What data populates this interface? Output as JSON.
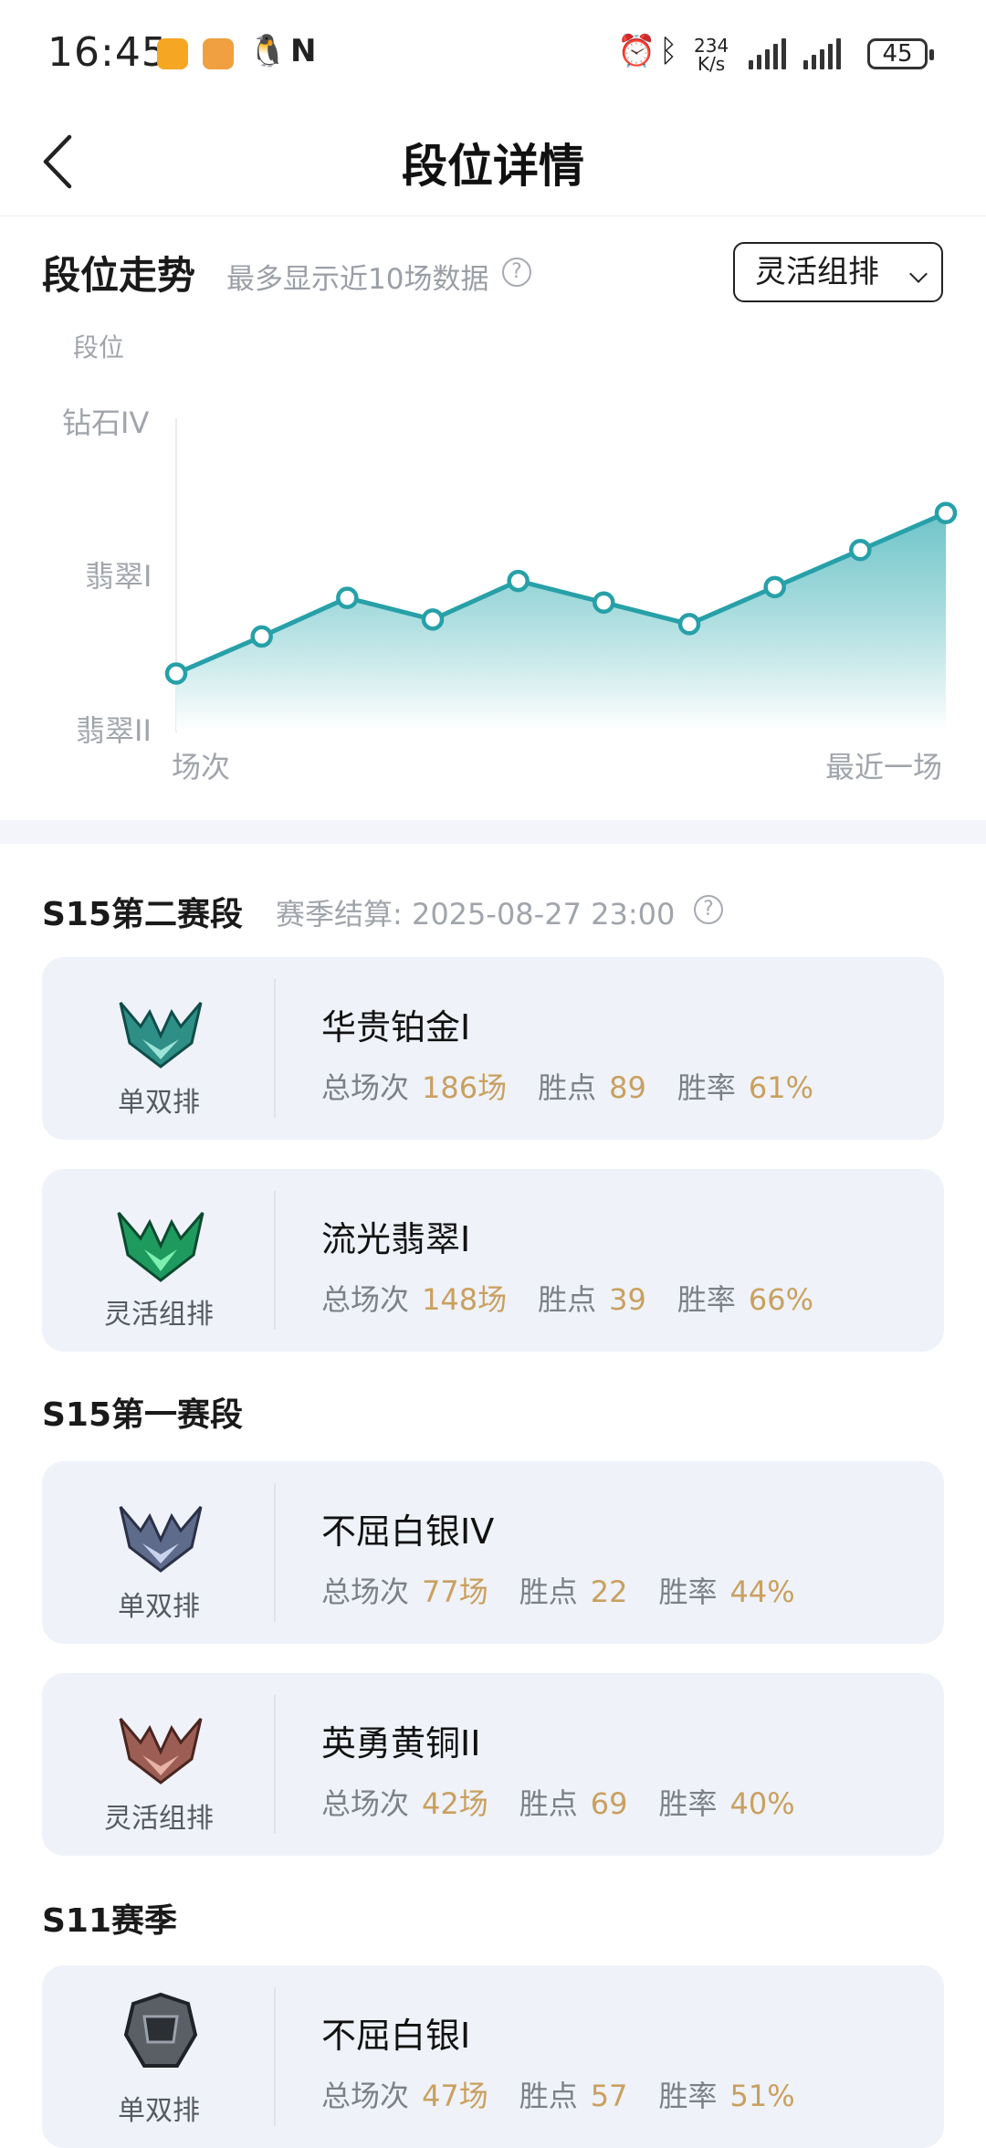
{
  "status_bar": {
    "time": "16:45",
    "net_speed_value": "234",
    "net_speed_unit": "K/s",
    "battery": "45"
  },
  "header": {
    "title": "段位详情"
  },
  "trend": {
    "title": "段位走势",
    "subtitle": "最多显示近10场数据",
    "mode_selected": "灵活组排",
    "chart_data": {
      "type": "area",
      "ylabel": "段位",
      "y_tick_labels": [
        "钻石IV",
        "翡翠I",
        "翡翠II"
      ],
      "x_start_label": "场次",
      "x_end_label": "最近一场",
      "y_scale": "rank tiers (翡翠II = 0, 翡翠I = 1, 钻石IV = 2)",
      "ylim": [
        0,
        2
      ],
      "x": [
        1,
        2,
        3,
        4,
        5,
        6,
        7,
        8,
        9,
        10
      ],
      "values": [
        0.37,
        0.61,
        0.86,
        0.72,
        0.97,
        0.83,
        0.69,
        0.93,
        1.17,
        1.41
      ],
      "colors": {
        "line": "#27a0a8",
        "fill_top": "#3fb1b6",
        "fill_bottom": "#ffffff"
      }
    }
  },
  "seasons": [
    {
      "title": "S15第二赛段",
      "note": "赛季结算: 2025-08-27 23:00",
      "cards": [
        {
          "queue": "单双排",
          "rank": "华贵铂金I",
          "games_label": "总场次",
          "games": "186场",
          "lp_label": "胜点",
          "lp": "89",
          "wr_label": "胜率",
          "wr": "61%",
          "emblem": "platinum-emblem-icon"
        },
        {
          "queue": "灵活组排",
          "rank": "流光翡翠I",
          "games_label": "总场次",
          "games": "148场",
          "lp_label": "胜点",
          "lp": "39",
          "wr_label": "胜率",
          "wr": "66%",
          "emblem": "emerald-emblem-icon"
        }
      ]
    },
    {
      "title": "S15第一赛段",
      "cards": [
        {
          "queue": "单双排",
          "rank": "不屈白银IV",
          "games_label": "总场次",
          "games": "77场",
          "lp_label": "胜点",
          "lp": "22",
          "wr_label": "胜率",
          "wr": "44%",
          "emblem": "silver-emblem-icon"
        },
        {
          "queue": "灵活组排",
          "rank": "英勇黄铜II",
          "games_label": "总场次",
          "games": "42场",
          "lp_label": "胜点",
          "lp": "69",
          "wr_label": "胜率",
          "wr": "40%",
          "emblem": "bronze-emblem-icon"
        }
      ]
    },
    {
      "title": "S11赛季",
      "cards": [
        {
          "queue": "单双排",
          "rank": "不屈白银I",
          "games_label": "总场次",
          "games": "47场",
          "lp_label": "胜点",
          "lp": "57",
          "wr_label": "胜率",
          "wr": "51%",
          "emblem": "silver-helmet-emblem-icon"
        }
      ]
    }
  ]
}
